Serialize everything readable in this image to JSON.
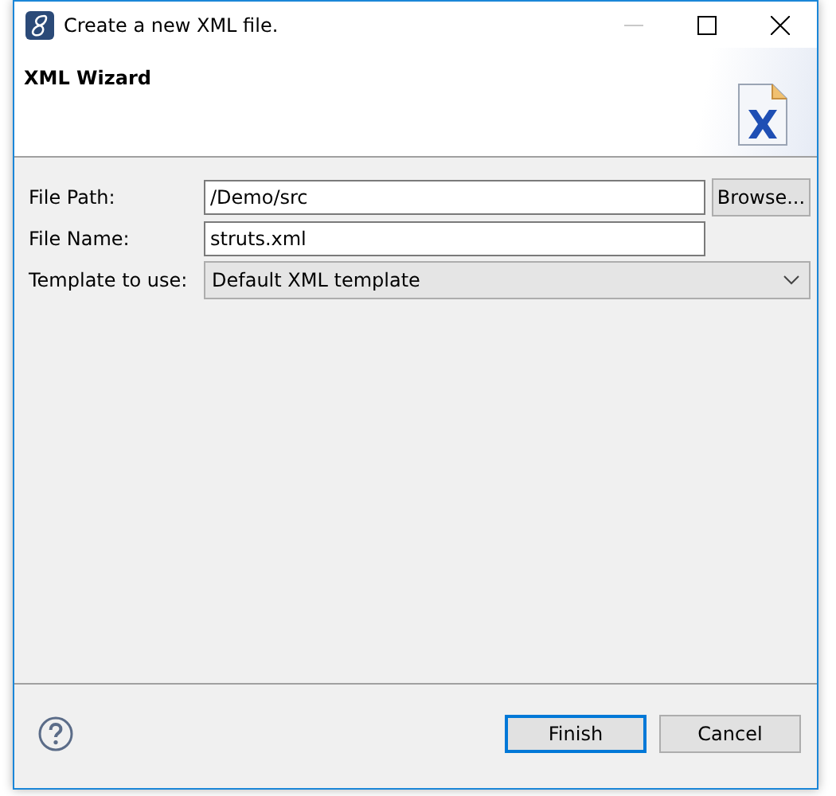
{
  "window": {
    "title": "Create a new XML file.",
    "minimize_disabled": true
  },
  "header": {
    "title": "XML Wizard"
  },
  "fields": [
    {
      "kind": "text",
      "label": "File Path:",
      "value": "/Demo/src",
      "button": "Browse..."
    },
    {
      "kind": "text",
      "label": "File Name:",
      "value": "struts.xml"
    },
    {
      "kind": "combo",
      "label": "Template to use:",
      "value": "Default XML template"
    }
  ],
  "buttons": [
    {
      "label": "Finish",
      "default": true
    },
    {
      "label": "Cancel",
      "default": false
    }
  ]
}
